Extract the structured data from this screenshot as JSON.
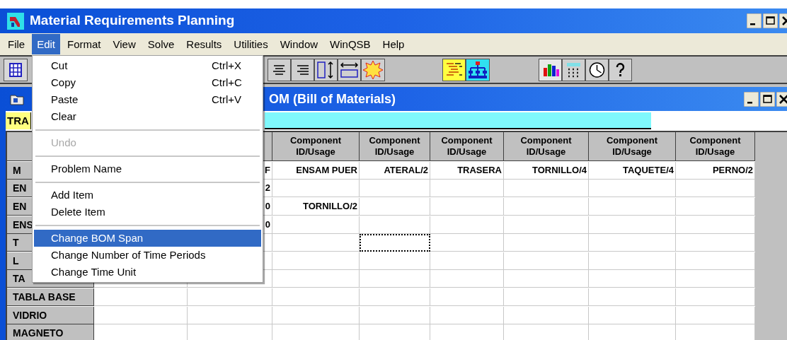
{
  "window": {
    "title": "Material Requirements Planning"
  },
  "menu_bar": [
    {
      "label": "File",
      "selected": false
    },
    {
      "label": "Edit",
      "selected": true
    },
    {
      "label": "Format",
      "selected": false
    },
    {
      "label": "View",
      "selected": false
    },
    {
      "label": "Solve",
      "selected": false
    },
    {
      "label": "Results",
      "selected": false
    },
    {
      "label": "Utilities",
      "selected": false
    },
    {
      "label": "Window",
      "selected": false
    },
    {
      "label": "WinQSB",
      "selected": false
    },
    {
      "label": "Help",
      "selected": false
    }
  ],
  "edit_menu": {
    "items": [
      {
        "kind": "item",
        "label": "Cut",
        "shortcut": "Ctrl+X",
        "disabled": false,
        "selected": false
      },
      {
        "kind": "item",
        "label": "Copy",
        "shortcut": "Ctrl+C",
        "disabled": false,
        "selected": false
      },
      {
        "kind": "item",
        "label": "Paste",
        "shortcut": "Ctrl+V",
        "disabled": false,
        "selected": false
      },
      {
        "kind": "item",
        "label": "Clear",
        "disabled": false,
        "selected": false
      },
      {
        "kind": "separator"
      },
      {
        "kind": "item",
        "label": "Undo",
        "disabled": true,
        "selected": false
      },
      {
        "kind": "separator"
      },
      {
        "kind": "item",
        "label": "Problem Name",
        "disabled": false,
        "selected": false
      },
      {
        "kind": "separator"
      },
      {
        "kind": "item",
        "label": "Add Item",
        "disabled": false,
        "selected": false
      },
      {
        "kind": "item",
        "label": "Delete Item",
        "disabled": false,
        "selected": false
      },
      {
        "kind": "separator"
      },
      {
        "kind": "item",
        "label": "Change BOM Span",
        "disabled": false,
        "selected": true
      },
      {
        "kind": "item",
        "label": "Change Number of Time Periods",
        "disabled": false,
        "selected": false
      },
      {
        "kind": "item",
        "label": "Change Time Unit",
        "disabled": false,
        "selected": false
      }
    ]
  },
  "child_window": {
    "title": "OM (Bill of Materials)"
  },
  "cell_editor": {
    "label": "TRA"
  },
  "table": {
    "columns": [
      null,
      null,
      "Component ID/Usage",
      "Component ID/Usage",
      "Component ID/Usage",
      "Component ID/Usage",
      "Component ID/Usage",
      "Component ID/Usage"
    ],
    "rows": [
      {
        "header": "M",
        "cells": [
          null,
          {
            "text": "F",
            "focused": false
          },
          {
            "text": "ENSAM PUER",
            "focused": false
          },
          {
            "text": "ATERAL/2",
            "focused": false
          },
          {
            "text": "TRASERA",
            "focused": false
          },
          {
            "text": "TORNILLO/4",
            "focused": false
          },
          {
            "text": "TAQUETE/4",
            "focused": false
          },
          {
            "text": "PERNO/2",
            "focused": false
          }
        ]
      },
      {
        "header": "EN",
        "cells": [
          null,
          {
            "text": "2",
            "focused": false
          },
          {
            "focused": false
          },
          {
            "focused": false
          },
          {
            "focused": false
          },
          {
            "focused": false
          },
          {
            "focused": false
          },
          {
            "focused": false
          }
        ]
      },
      {
        "header": "EN",
        "cells": [
          null,
          {
            "text": "0",
            "focused": false
          },
          {
            "text": "TORNILLO/2",
            "focused": false
          },
          {
            "focused": false
          },
          {
            "focused": false
          },
          {
            "focused": false
          },
          {
            "focused": false
          },
          {
            "focused": false
          }
        ]
      },
      {
        "header": "ENS",
        "cells": [
          null,
          {
            "text": "0",
            "focused": false
          },
          {
            "focused": false
          },
          {
            "focused": false
          },
          {
            "focused": false
          },
          {
            "focused": false
          },
          {
            "focused": false
          },
          {
            "focused": false
          }
        ]
      },
      {
        "header": "T",
        "cells": [
          null,
          {
            "focused": false
          },
          {
            "focused": false
          },
          {
            "focused": true
          },
          {
            "focused": false
          },
          {
            "focused": false
          },
          {
            "focused": false
          },
          {
            "focused": false
          }
        ]
      },
      {
        "header": "L",
        "cells": [
          null,
          {
            "focused": false
          },
          {
            "focused": false
          },
          {
            "focused": false
          },
          {
            "focused": false
          },
          {
            "focused": false
          },
          {
            "focused": false
          },
          {
            "focused": false
          }
        ]
      },
      {
        "header": "TA",
        "cells": [
          null,
          {
            "focused": false
          },
          {
            "focused": false
          },
          {
            "focused": false
          },
          {
            "focused": false
          },
          {
            "focused": false
          },
          {
            "focused": false
          },
          {
            "focused": false
          }
        ]
      },
      {
        "header": "TABLA BASE",
        "cells": [
          {
            "focused": false
          },
          {
            "focused": false
          },
          {
            "focused": false
          },
          {
            "focused": false
          },
          {
            "focused": false
          },
          {
            "focused": false
          },
          {
            "focused": false
          },
          {
            "focused": false
          }
        ]
      },
      {
        "header": "VIDRIO",
        "cells": [
          {
            "focused": false
          },
          {
            "focused": false
          },
          {
            "focused": false
          },
          {
            "focused": false
          },
          {
            "focused": false
          },
          {
            "focused": false
          },
          {
            "focused": false
          },
          {
            "focused": false
          }
        ]
      },
      {
        "header": "MAGNETO",
        "cells": [
          {
            "focused": false
          },
          {
            "focused": false
          },
          {
            "focused": false
          },
          {
            "focused": false
          },
          {
            "focused": false
          },
          {
            "focused": false
          },
          {
            "focused": false
          },
          {
            "focused": false
          }
        ]
      }
    ]
  }
}
